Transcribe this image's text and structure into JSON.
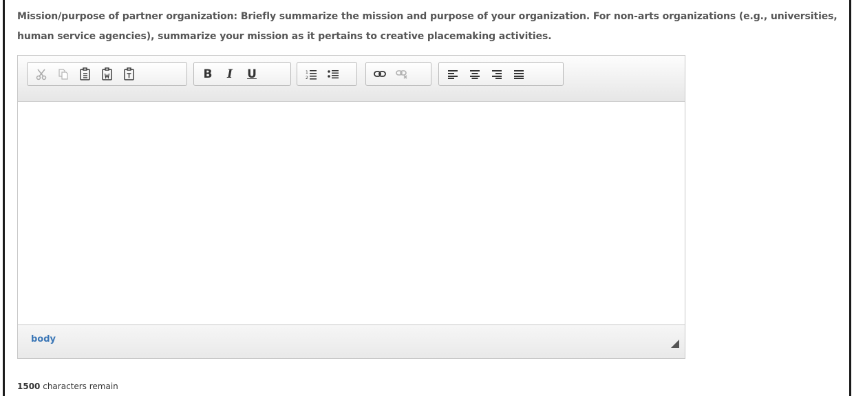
{
  "question": {
    "text": "Mission/purpose of partner organization: Briefly summarize the mission and purpose of your organization. For non-arts organizations (e.g., universities, human service agencies), summarize your mission as it pertains to creative placemaking activities."
  },
  "toolbar": {
    "bold": "B",
    "italic": "I",
    "underline": "U"
  },
  "statusbar": {
    "path": "body"
  },
  "counter": {
    "count": "1500",
    "suffix": " characters remain"
  },
  "colors": {
    "question_text": "#555555",
    "path_link": "#3a76b6",
    "border": "#c7c7c7",
    "frame": "#1a1a1a"
  }
}
